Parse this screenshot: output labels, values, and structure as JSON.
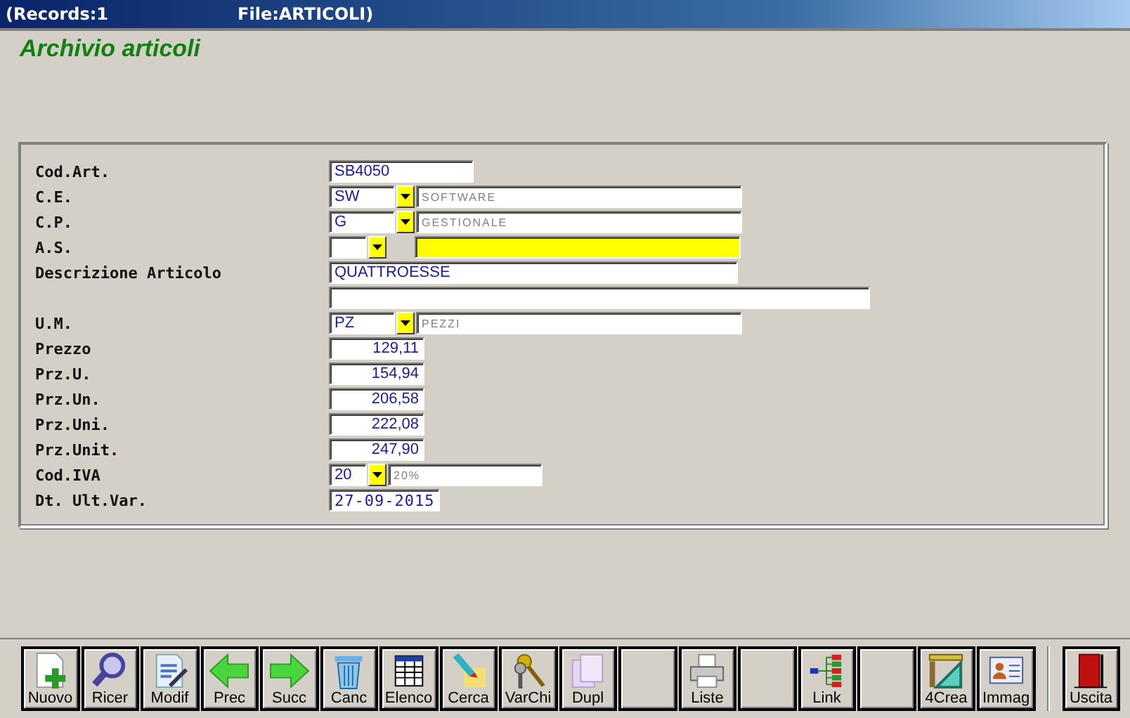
{
  "title_bar": {
    "records": "(Records:1",
    "file": "File:ARTICOLI)"
  },
  "heading": "Archivio articoli",
  "fields": [
    {
      "kind": "code",
      "label": "Cod.Art.",
      "value": "SB4050"
    },
    {
      "kind": "combo",
      "label": "C.E.",
      "value": "SW",
      "description": "SOFTWARE"
    },
    {
      "kind": "combo",
      "label": "C.P.",
      "value": "G",
      "description": "GESTIONALE"
    },
    {
      "kind": "combo-short",
      "label": "A.S.",
      "highlighted": true
    },
    {
      "kind": "description",
      "label": "Descrizione Articolo",
      "value": "QUATTROESSE"
    },
    {
      "kind": "blank"
    },
    {
      "kind": "combo",
      "label": "U.M.",
      "value": "PZ",
      "description": "PEZZI"
    },
    {
      "kind": "price",
      "label": "Prezzo",
      "value": "129,11"
    },
    {
      "kind": "price",
      "label": "Prz.U.",
      "value": "154,94"
    },
    {
      "kind": "price",
      "label": "Prz.Un.",
      "value": "206,58"
    },
    {
      "kind": "price",
      "label": "Prz.Uni.",
      "value": "222,08"
    },
    {
      "kind": "price",
      "label": "Prz.Unit.",
      "value": "247,90"
    },
    {
      "kind": "combo-iva",
      "label": "Cod.IVA",
      "value": "20",
      "description": "20%"
    },
    {
      "kind": "date",
      "label": "Dt. Ult.Var.",
      "value": "27-09-2015"
    }
  ],
  "toolbar": [
    {
      "kind": "new",
      "label": "Nuovo"
    },
    {
      "kind": "search",
      "label": "Ricer"
    },
    {
      "kind": "edit",
      "label": "Modif"
    },
    {
      "kind": "left",
      "label": "Prec"
    },
    {
      "kind": "right",
      "label": "Succ"
    },
    {
      "kind": "trash",
      "label": "Canc"
    },
    {
      "kind": "table",
      "label": "Elenco"
    },
    {
      "kind": "pen",
      "label": "Cerca"
    },
    {
      "kind": "keys",
      "label": "VarChi"
    },
    {
      "kind": "copy",
      "label": "Dupl"
    },
    {
      "kind": "empty"
    },
    {
      "kind": "printer",
      "label": "Liste"
    },
    {
      "kind": "empty"
    },
    {
      "kind": "tree",
      "label": "Link"
    },
    {
      "kind": "empty"
    },
    {
      "kind": "ruler",
      "label": "4Crea"
    },
    {
      "kind": "card",
      "label": "Immag"
    },
    {
      "kind": "door",
      "label": "Uscita",
      "separated": true
    }
  ]
}
